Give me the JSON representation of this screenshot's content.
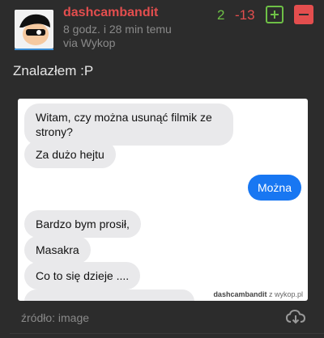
{
  "entry": {
    "username": "dashcambandit",
    "timestamp": "8 godz. i 28 min temu",
    "source": "via Wykop",
    "votes_plus": "2",
    "votes_minus": "-13",
    "text": "Znalazłem :P",
    "embed_label": "źródło: image"
  },
  "screenshot": {
    "messages": [
      {
        "from": "them",
        "text": "Witam, czy można usunąć filmik ze strony?"
      },
      {
        "from": "them",
        "text": "Za dużo hejtu"
      },
      {
        "from": "me",
        "text": "Można"
      },
      {
        "from": "them",
        "text": "Bardzo bym prosił,"
      },
      {
        "from": "them",
        "text": "Masakra"
      },
      {
        "from": "them",
        "text": "Co to się dzieje ...."
      }
    ],
    "watermark_user": "dashcambandit",
    "watermark_site": "z wykop.pl"
  },
  "colors": {
    "accent_red": "#e34e4e",
    "accent_green": "#6ec046",
    "messenger_blue": "#1877f2"
  },
  "icons": {
    "upvote": "plus-square-icon",
    "downvote": "minus-square-icon",
    "download": "cloud-download-icon"
  }
}
